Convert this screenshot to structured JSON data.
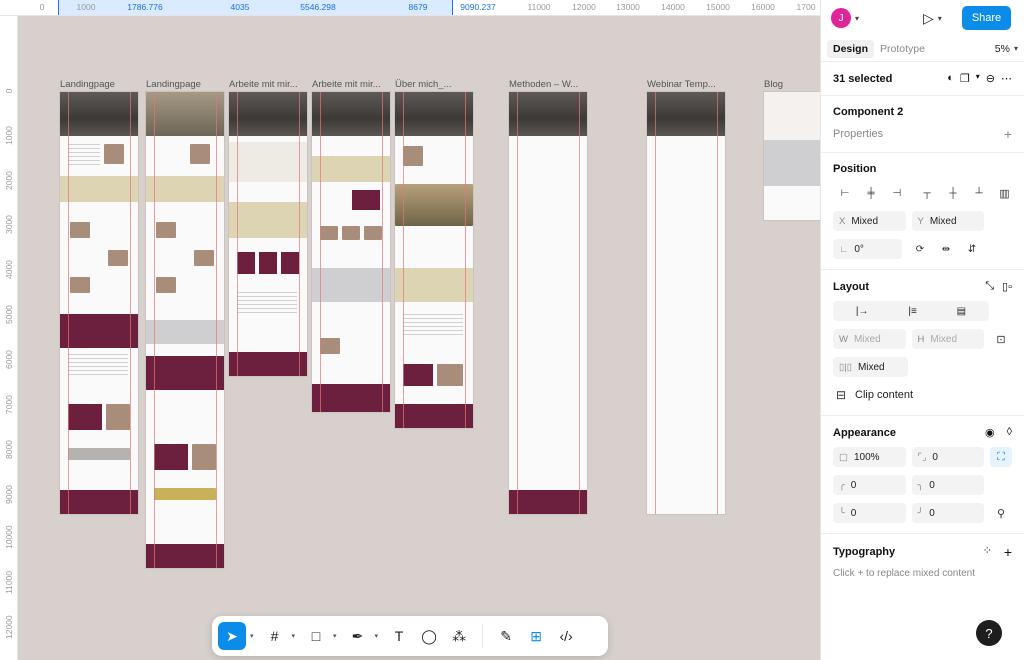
{
  "ruler": {
    "top_ticks": [
      "0",
      "1000",
      "1786.776",
      "4035",
      "5546.298",
      "8679",
      "9090.237",
      "11000",
      "12000",
      "13000",
      "14000",
      "15000",
      "16000",
      "1700"
    ],
    "left_ticks": [
      "0",
      "1000",
      "2000",
      "3000",
      "4000",
      "5000",
      "6000",
      "7000",
      "8000",
      "9000",
      "10000",
      "11000",
      "12000"
    ]
  },
  "frames": [
    {
      "label": "Landingpage"
    },
    {
      "label": "Landingpage"
    },
    {
      "label": "Arbeite mit mir..."
    },
    {
      "label": "Arbeite mit mir..."
    },
    {
      "label": "Über mich_..."
    },
    {
      "label": "Methoden – W..."
    },
    {
      "label": "Webinar Temp..."
    },
    {
      "label": "Blog"
    }
  ],
  "header": {
    "avatar_initial": "J",
    "share_label": "Share"
  },
  "tabs": {
    "design": "Design",
    "prototype": "Prototype",
    "zoom": "5%"
  },
  "selection": {
    "count_label": "31 selected"
  },
  "component": {
    "title": "Component 2",
    "properties_label": "Properties"
  },
  "position": {
    "title": "Position",
    "x_label": "X",
    "x_value": "Mixed",
    "y_label": "Y",
    "y_value": "Mixed",
    "rotation": "0°"
  },
  "layout": {
    "title": "Layout",
    "w_label": "W",
    "w_value": "Mixed",
    "h_label": "H",
    "h_value": "Mixed",
    "gap_value": "Mixed",
    "clip_content": "Clip content"
  },
  "appearance": {
    "title": "Appearance",
    "opacity": "100%",
    "radius": "0",
    "corner_tl": "0",
    "corner_tr": "0",
    "corner_bl": "0",
    "corner_br": "0"
  },
  "typography": {
    "title": "Typography",
    "hint": "Click + to replace mixed content"
  },
  "help_label": "?",
  "colors": {
    "accent": "#0c8ce9",
    "brand_wine": "#6d1f3e",
    "olive": "#dcd4b3",
    "canvas": "#d7d0cc"
  }
}
